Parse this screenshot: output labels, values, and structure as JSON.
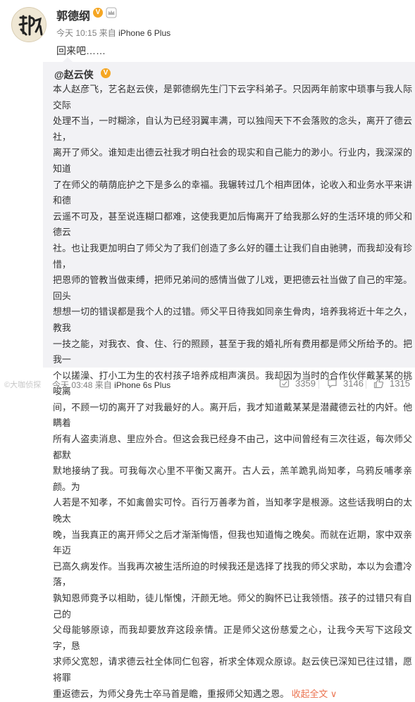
{
  "weibo_post": {
    "author": {
      "name": "郭德纲",
      "verified_badge": "V",
      "avatar_text": "郭德纲",
      "vip_icon": "crown-icon"
    },
    "meta": {
      "time": "今天 10:15",
      "source_prefix": "来自",
      "source": "iPhone 6 Plus"
    },
    "text": "回来吧……"
  },
  "repost": {
    "author": "@赵云侠",
    "verified_badge": "V",
    "body_lines": [
      "本人赵彦飞，艺名赵云侠，是郭德纲先生门下云字科弟子。只因两年前家中琐事与我人际交际",
      "处理不当，一时糊涂，自认为已经羽翼丰满，可以独闯天下不会落败的念头，离开了德云社，",
      "离开了师父。谁知走出德云社我才明白社会的现实和自己能力的渺小。行业内，我深深的知道",
      "了在师父的萌荫庇护之下是多么的幸福。我辗转过几个相声团体，论收入和业务水平来讲和德",
      "云遥不可及，甚至说连糊口都难，这使我更加后悔离开了给我那么好的生活环境的师父和德云",
      "社。也让我更加明白了师父为了我们创造了多么好的疆土让我们自由驰骋，而我却没有珍惜，",
      "把恩师的管教当做束缚，把师兄弟间的感情当做了儿戏，更把德云社当做了自己的牢笼。回头",
      "想想一切的错误都是我个人的过错。师父平日待我如同亲生骨肉，培养我将近十年之久，教我",
      "一技之能，对我衣、食、住、行的照顾，甚至于我的婚礼所有费用都是师父所给予的。把我一",
      "个以搓澡、打小工为生的农村孩子培养成相声演员。我却因为当时的合作伙伴戴某某的挑唆离",
      "间，不顾一切的离开了对我最好的人。离开后，我才知道戴某某是潜藏德云社的内奸。他瞒着",
      "所有人盗卖消息、里应外合。但这会我已经身不由己，这中间曾经有三次往返，每次师父都默",
      "默地接纳了我。可我每次心里不平衡又离开。古人云，羔羊跪乳尚知孝，乌鸦反哺孝亲颜。为",
      "人若是不知孝，不如禽兽实可怜。百行万善孝为首，当知孝字是根源。这些话我明白的太晚太",
      "晚，当我真正的离开师父之后才渐渐悔悟，但我也知道悔之晚矣。而就在近期，家中双亲年迈",
      "已高久病发作。当我再次被生活所迫的时候我还是选择了找我的师父求助，本以为会遭冷落，",
      "孰知恩师竟予以相助，徒儿惭愧，汗颜无地。师父的胸怀已让我领悟。孩子的过错只有自己的",
      "父母能够原谅，而我却要放弃这段亲情。正是师父这份慈爱之心，让我今天写下这段文字，恳",
      "求师父宽恕，请求德云社全体同仁包容，祈求全体观众原谅。赵云侠已深知已往过错，愿将罪",
      "重返德云，为师父身先士卒马首是瞻，重报师父知遇之恩。"
    ],
    "expand_label": "收起全文",
    "expand_arrow": "∨",
    "meta": {
      "time": "今天 03:48",
      "source_prefix": "来自",
      "source": "iPhone 6s Plus"
    },
    "watermark": "©大咖侦探",
    "actions": {
      "repost_count": "3359",
      "comment_count": "3146",
      "like_count": "1315"
    }
  },
  "colors": {
    "link": "#eb7350",
    "muted": "#808080",
    "repost_bg": "#f2f2f5",
    "verified": "#f5a623"
  }
}
